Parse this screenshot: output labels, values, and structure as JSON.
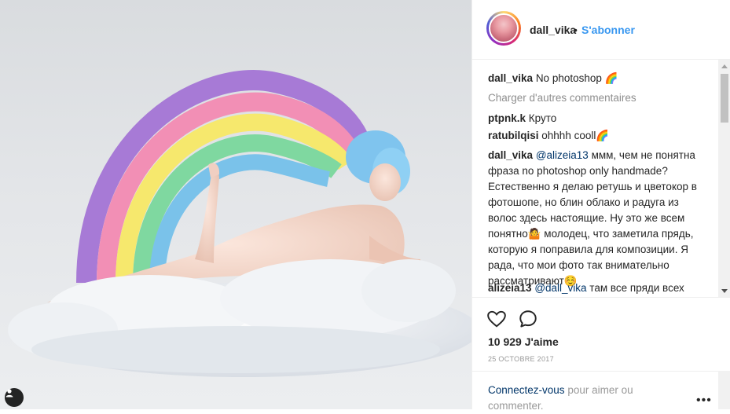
{
  "post": {
    "username": "dall_vika",
    "separator": "•",
    "follow_label": "S'abonner"
  },
  "comments": {
    "caption": {
      "user": "dall_vika",
      "text": "No photoshop 🌈"
    },
    "load_more": "Charger d'autres commentaires",
    "items": [
      {
        "user": "ptpnk.k",
        "text": "Круто"
      },
      {
        "user": "ratubilqisi",
        "text": "ohhhh cooll🌈"
      }
    ],
    "reply": {
      "user": "dall_vika",
      "mention": "@alizeia13",
      "text": " ммм, чем не понятна фраза no photoshop only handmade? Естественно я делаю ретушь и цветокор в фотошопе, но блин облако и радуга из волос здесь настоящие. Ну это же всем понятно🤷 молодец, что заметила прядь, которую я поправила для композиции. Я рада, что мои фото так внимательно рассматривают☺️"
    },
    "last": {
      "user": "alizeia13",
      "mention": "@dall_vika",
      "text": " там все пряди всех"
    }
  },
  "actions": {
    "like_icon": "heart-icon",
    "comment_icon": "comment-bubble-icon"
  },
  "likes_text": "10 929 J'aime",
  "date_text": "25 OCTOBRE 2017",
  "login": {
    "link": "Connectez-vous",
    "rest": " pour aimer ou commenter.",
    "more_label": "•••"
  },
  "colors": {
    "accent": "#3897f0",
    "link": "#003569",
    "muted": "#8e8e8e"
  }
}
